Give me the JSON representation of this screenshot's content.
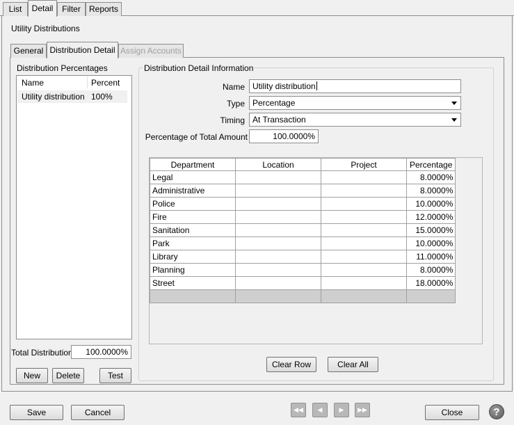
{
  "top_tabs": [
    {
      "label": "List"
    },
    {
      "label": "Detail"
    },
    {
      "label": "Filter"
    },
    {
      "label": "Reports"
    }
  ],
  "page_title": "Utility Distributions",
  "inner_tabs": [
    {
      "label": "General"
    },
    {
      "label": "Distribution Detail"
    },
    {
      "label": "Assign Accounts"
    }
  ],
  "percentages": {
    "title": "Distribution Percentages",
    "col_name": "Name",
    "col_percent": "Percent",
    "rows": [
      {
        "name": "Utility distribution",
        "percent": "100%"
      }
    ],
    "total_label": "Total Distribution",
    "total_value": "100.0000%",
    "new_button": "New",
    "delete_button": "Delete",
    "test_button": "Test"
  },
  "detail": {
    "title": "Distribution Detail Information",
    "name_label": "Name",
    "name_value": "Utility distribution",
    "type_label": "Type",
    "type_value": "Percentage",
    "timing_label": "Timing",
    "timing_value": "At Transaction",
    "pct_total_label": "Percentage of Total Amount",
    "pct_total_value": "100.0000%",
    "grid": {
      "columns": [
        "Department",
        "Location",
        "Project",
        "Percentage"
      ],
      "rows": [
        {
          "department": "Legal",
          "location": "",
          "project": "",
          "percentage": "8.0000%"
        },
        {
          "department": "Administrative",
          "location": "",
          "project": "",
          "percentage": "8.0000%"
        },
        {
          "department": "Police",
          "location": "",
          "project": "",
          "percentage": "10.0000%"
        },
        {
          "department": "Fire",
          "location": "",
          "project": "",
          "percentage": "12.0000%"
        },
        {
          "department": "Sanitation",
          "location": "",
          "project": "",
          "percentage": "15.0000%"
        },
        {
          "department": "Park",
          "location": "",
          "project": "",
          "percentage": "10.0000%"
        },
        {
          "department": "Library",
          "location": "",
          "project": "",
          "percentage": "11.0000%"
        },
        {
          "department": "Planning",
          "location": "",
          "project": "",
          "percentage": "8.0000%"
        },
        {
          "department": "Street",
          "location": "",
          "project": "",
          "percentage": "18.0000%"
        }
      ]
    },
    "clear_row_button": "Clear Row",
    "clear_all_button": "Clear All"
  },
  "footer": {
    "save_button": "Save",
    "cancel_button": "Cancel",
    "close_button": "Close",
    "nav_first": "◀◀",
    "nav_prev": "◀",
    "nav_next": "▶",
    "nav_last": "▶▶",
    "help_glyph": "?"
  },
  "colors": {
    "background": "#f0f0f0",
    "border": "#8d8d8d",
    "selected_row": "#f0f0f0",
    "new_row": "#cfcfcf"
  }
}
